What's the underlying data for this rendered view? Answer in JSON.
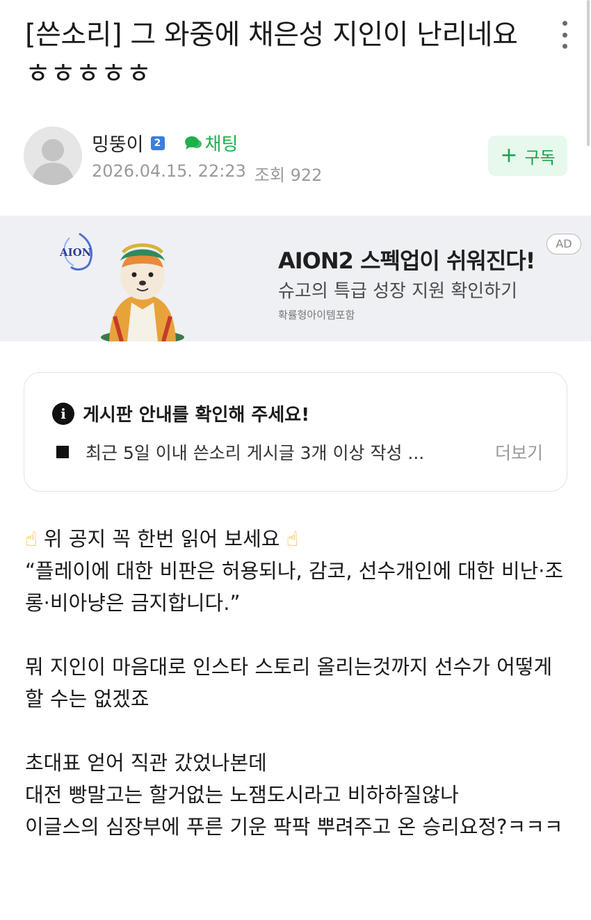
{
  "post": {
    "title": "[쓴소리] 그 와중에 채은성 지인이 난리네요 ㅎㅎㅎㅎㅎ"
  },
  "author": {
    "name": "밍뚱이",
    "level": "2",
    "chat_label": "채팅",
    "date": "2026.04.15. 22:23",
    "views_label": "조회 922",
    "subscribe_label": "구독"
  },
  "ad": {
    "logo_text": "AION",
    "headline": "AION2 스펙업이 쉬워진다!",
    "subline": "슈고의 특급 성장 지원 확인하기",
    "note": "확률형아이템포함",
    "badge": "AD"
  },
  "notice": {
    "title": "게시판 안내를 확인해 주세요!",
    "item": "최근 5일 이내 쓴소리 게시글 3개 이상 작성 ...",
    "more_label": "더보기"
  },
  "body": {
    "line1": "위 공지 꼭 한번 읽어 보세요",
    "line2": "“플레이에 대한 비판은 허용되나, 감코, 선수개인에 대한 비난·조롱·비아냥은 금지합니다.”",
    "line3": "뭐 지인이 마음대로 인스타 스토리 올리는것까지 선수가 어떻게 할 수는 없겠죠",
    "line4": "초대표 얻어 직관 갔었나본데",
    "line5": "대전 빵말고는 할거없는 노잼도시라고 비하하질않나",
    "line6": "이글스의 심장부에 푸른 기운 팍팍 뿌려주고 온 승리요정?ㅋㅋㅋ"
  },
  "colors": {
    "accent_green": "#1fb04a",
    "level_blue": "#3b7de0",
    "ad_bg": "#eef0f4"
  }
}
